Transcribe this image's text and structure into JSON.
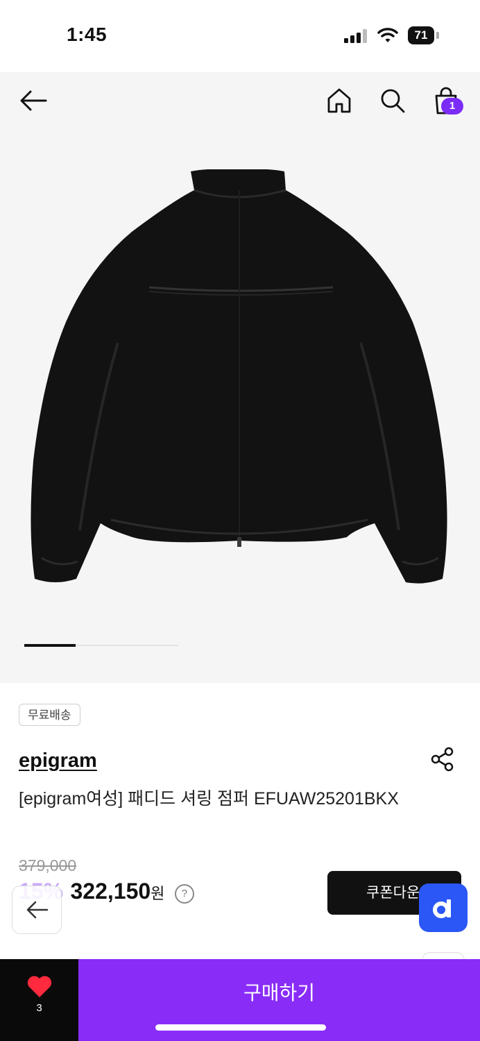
{
  "status_bar": {
    "time": "1:45",
    "battery": "71"
  },
  "header": {
    "cart_count": "1"
  },
  "gallery": {
    "current_index": 1,
    "total": 3
  },
  "product": {
    "badge": "무료배송",
    "brand": "epigram",
    "name": "[epigram여성] 패디드 셔링 점퍼 EFUAW25201BKX",
    "original_price": "379,000",
    "discount": "15%",
    "price": "322,150",
    "currency": "원",
    "help": "?"
  },
  "actions": {
    "coupon_label": "쿠폰다운",
    "like_count": "3",
    "buy_label": "구매하기"
  },
  "colors": {
    "accent": "#8a2cf8",
    "badge": "#7b2cf6",
    "discount": "#c9a8fb",
    "d_button": "#2a57f5"
  }
}
